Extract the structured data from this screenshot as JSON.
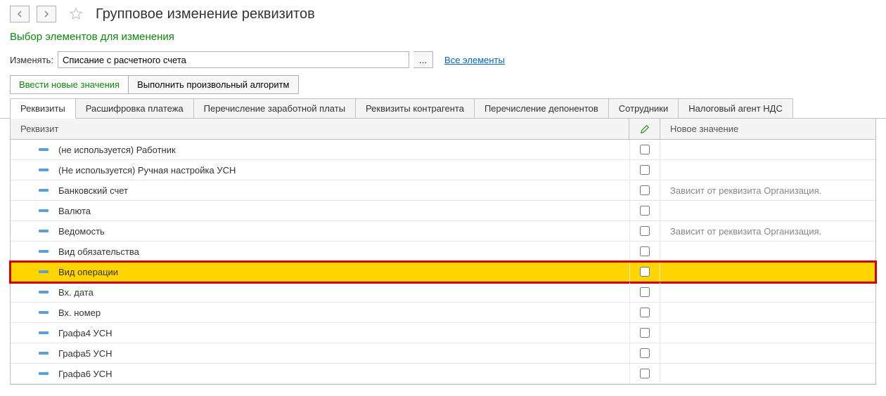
{
  "header": {
    "title": "Групповое изменение реквизитов",
    "subtitle": "Выбор элементов для изменения"
  },
  "change": {
    "label": "Изменять:",
    "value": "Списание с расчетного счета",
    "all_link": "Все элементы"
  },
  "modes": {
    "enter_values": "Ввести новые значения",
    "run_algorithm": "Выполнить произвольный алгоритм"
  },
  "tabs": [
    "Реквизиты",
    "Расшифровка платежа",
    "Перечисление заработной платы",
    "Реквизиты контрагента",
    "Перечисление депонентов",
    "Сотрудники",
    "Налоговый агент НДС"
  ],
  "columns": {
    "requisite": "Реквизит",
    "new_value": "Новое значение"
  },
  "rows": [
    {
      "label": "(не используется) Работник",
      "value": "",
      "highlight": false
    },
    {
      "label": "(Не используется) Ручная настройка УСН",
      "value": "",
      "highlight": false
    },
    {
      "label": "Банковский счет",
      "value": "Зависит от реквизита Организация.",
      "highlight": false
    },
    {
      "label": "Валюта",
      "value": "",
      "highlight": false
    },
    {
      "label": "Ведомость",
      "value": "Зависит от реквизита Организация.",
      "highlight": false
    },
    {
      "label": "Вид обязательства",
      "value": "",
      "highlight": false
    },
    {
      "label": "Вид операции",
      "value": "",
      "highlight": true
    },
    {
      "label": "Вх. дата",
      "value": "",
      "highlight": false
    },
    {
      "label": "Вх. номер",
      "value": "",
      "highlight": false
    },
    {
      "label": "Графа4 УСН",
      "value": "",
      "highlight": false
    },
    {
      "label": "Графа5 УСН",
      "value": "",
      "highlight": false
    },
    {
      "label": "Графа6 УСН",
      "value": "",
      "highlight": false
    }
  ]
}
